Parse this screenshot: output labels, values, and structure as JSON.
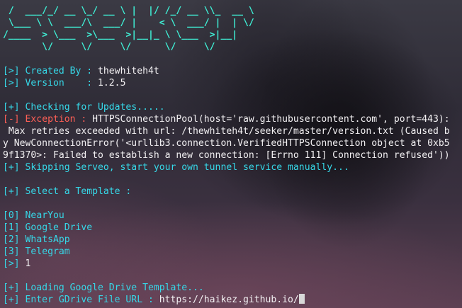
{
  "banner": [
    " /  ___/_/ __ \\_/ __ \\ |  |/ /_/ __ \\\\_  __ \\",
    " \\___ \\ \\  ___/\\  ___/ |    < \\  ___/ |  | \\/",
    "/____  > \\___  >\\___  >|__|_ \\ \\___  >|__|",
    "       \\/     \\/     \\/      \\/     \\/"
  ],
  "info": {
    "created_tag": "[>]",
    "created_label": " Created By : ",
    "created_value": "thewhiteh4t",
    "version_tag": "[>]",
    "version_label": " Version    : ",
    "version_value": "1.2.5"
  },
  "updates": {
    "checking": "[+] Checking for Updates.....",
    "exception_tag": "[-]",
    "exception_label": " Exception : ",
    "exception_lines": [
      "HTTPSConnectionPool(host='raw.githubusercontent.com', port=443):",
      " Max retries exceeded with url: /thewhiteh4t/seeker/master/version.txt (Caused b",
      "y NewConnectionError('<urllib3.connection.VerifiedHTTPSConnection object at 0xb5",
      "9f1370>: Failed to establish a new connection: [Errno 111] Connection refused'))"
    ],
    "skipping": "[+] Skipping Serveo, start your own tunnel service manually..."
  },
  "templates": {
    "prompt": "[+] Select a Template :",
    "options": [
      {
        "index": "[0]",
        "name": "NearYou"
      },
      {
        "index": "[1]",
        "name": "Google Drive"
      },
      {
        "index": "[2]",
        "name": "WhatsApp"
      },
      {
        "index": "[3]",
        "name": "Telegram"
      }
    ],
    "choice_tag": "[>]",
    "choice_value": "1"
  },
  "loading": {
    "message": "[+] Loading Google Drive Template...",
    "url_prompt": "[+] Enter GDrive File URL : ",
    "url_value": "https://haikez.github.io/"
  },
  "colors": {
    "banner": "#3ff0d6",
    "prompt": "#36d8e8",
    "error": "#ff5f56",
    "text": "#f2f0f2"
  }
}
